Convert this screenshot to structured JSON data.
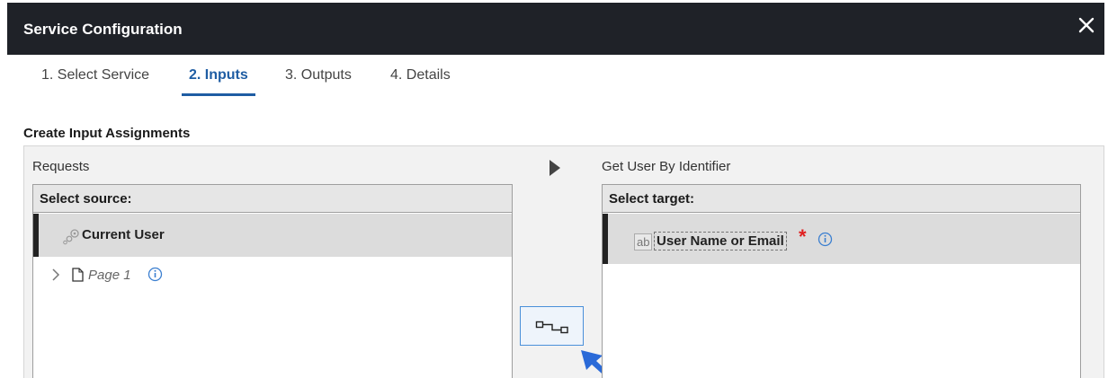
{
  "dialog": {
    "title": "Service Configuration",
    "close_label": "×"
  },
  "tabs": [
    {
      "label": "1. Select Service",
      "active": false
    },
    {
      "label": "2. Inputs",
      "active": true
    },
    {
      "label": "3. Outputs",
      "active": false
    },
    {
      "label": "4. Details",
      "active": false
    }
  ],
  "section": {
    "title": "Create Input Assignments"
  },
  "source_pane": {
    "label": "Requests",
    "header": "Select source:",
    "items": [
      {
        "label": "Current User",
        "icon": "gears-icon",
        "selected": true
      },
      {
        "label": "Page 1",
        "icon": "page-icon",
        "expandable": true,
        "info": true
      }
    ]
  },
  "target_pane": {
    "label": "Get User By Identifier",
    "header": "Select target:",
    "items": [
      {
        "type_badge": "ab",
        "label": "User Name or Email",
        "required_mark": "*",
        "info": true,
        "selected": true
      }
    ]
  },
  "colors": {
    "titlebar_bg": "#1f2228",
    "accent": "#1f5da3",
    "required": "#e02020",
    "info": "#3b7fd0",
    "arrow": "#2a6ad8"
  }
}
